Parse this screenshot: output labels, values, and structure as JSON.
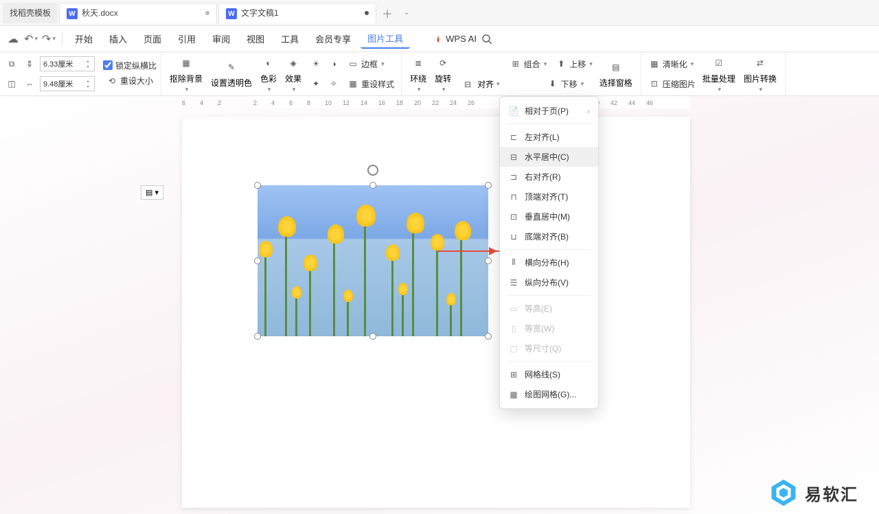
{
  "tabs": {
    "t0": "找稻壳模板",
    "t1": "秋天.docx",
    "t2": "文字文稿1"
  },
  "menu": {
    "begin": "开始",
    "insert": "插入",
    "page": "页面",
    "ref": "引用",
    "review": "审阅",
    "view": "视图",
    "tools": "工具",
    "vip": "会员专享",
    "pictool": "图片工具",
    "wpsai": "WPS AI"
  },
  "size": {
    "h": "6.33厘米",
    "w": "9.48厘米",
    "lock": "锁定纵横比",
    "reset": "重设大小"
  },
  "ribbon": {
    "matting": "抠除背景",
    "trans": "设置透明色",
    "color": "色彩",
    "effect": "效果",
    "border": "边框",
    "resetstyle": "重设样式",
    "wrap": "环绕",
    "rotate": "旋转",
    "align": "对齐",
    "group": "组合",
    "up": "上移",
    "down": "下移",
    "selpane": "选择窗格",
    "sharpen": "清晰化",
    "compress": "压缩图片",
    "batch": "批量处理",
    "convert": "图片转换"
  },
  "dropdown": {
    "relpage": "相对于页(P)",
    "left": "左对齐(L)",
    "hcenter": "水平居中(C)",
    "right": "右对齐(R)",
    "top": "顶端对齐(T)",
    "vcenter": "垂直居中(M)",
    "bottom": "底端对齐(B)",
    "hdist": "横向分布(H)",
    "vdist": "纵向分布(V)",
    "eqh": "等高(E)",
    "eqw": "等宽(W)",
    "eqsize": "等尺寸(Q)",
    "gridline": "网格线(S)",
    "drawgrid": "绘图网格(G)..."
  },
  "ruler": [
    "6",
    "4",
    "2",
    "",
    "2",
    "4",
    "6",
    "8",
    "10",
    "12",
    "14",
    "16",
    "18",
    "20",
    "22",
    "24",
    "26",
    "",
    "",
    "",
    "",
    "",
    "",
    "40",
    "42",
    "44",
    "46"
  ],
  "logo": "易软汇"
}
